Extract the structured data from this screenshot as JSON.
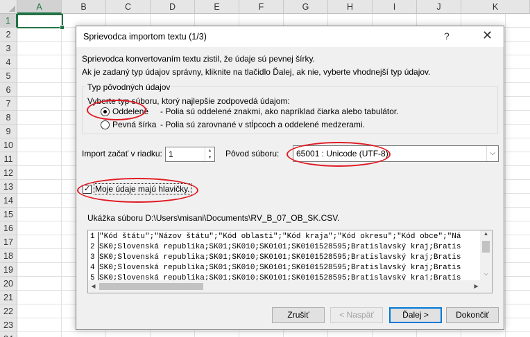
{
  "spreadsheet": {
    "columns": [
      "A",
      "B",
      "C",
      "D",
      "E",
      "F",
      "G",
      "H",
      "I",
      "J",
      "K"
    ],
    "rows": [
      "1",
      "2",
      "3",
      "4",
      "5",
      "6",
      "7",
      "8",
      "9",
      "10",
      "11",
      "12",
      "13",
      "14",
      "15",
      "16",
      "17",
      "18",
      "19",
      "20",
      "21",
      "22",
      "23",
      "24"
    ],
    "selected_column": "A",
    "selected_row": "1",
    "accent_color": "#217346"
  },
  "dialog": {
    "title": "Sprievodca importom textu (1/3)",
    "help_icon": "?",
    "close_icon": "✕",
    "intro_line1": "Sprievodca konvertovaním textu zistil, že údaje sú pevnej šírky.",
    "intro_line2": "Ak je zadaný typ údajov správny, kliknite na tlačidlo Ďalej, ak nie, vyberte vhodnejší typ údajov.",
    "group": {
      "legend": "Typ pôvodných údajov",
      "hint": "Vyberte typ súboru, ktorý najlepšie zodpovedá údajom:",
      "options": [
        {
          "label": "Oddelené",
          "description": "- Polia sú oddelené znakmi, ako napríklad čiarka alebo tabulátor.",
          "selected": true
        },
        {
          "label": "Pevná šírka",
          "description": "- Polia sú zarovnané v stĺpcoch a oddelené medzerami.",
          "selected": false
        }
      ]
    },
    "start_row": {
      "label": "Import začať v riadku:",
      "value": "1"
    },
    "origin": {
      "label": "Pôvod súboru:",
      "value": "65001 : Unicode (UTF-8)"
    },
    "headers": {
      "label": "Moje údaje majú hlavičky.",
      "checked": true,
      "check_glyph": "✓"
    },
    "preview": {
      "label": "Ukážka súboru D:\\Users\\misani\\Documents\\RV_B_07_OB_SK.CSV.",
      "rows": [
        {
          "num": "1",
          "text": "\"Kód štátu\";\"Názov štátu\";\"Kód oblasti\";\"Kód kraja\";\"Kód okresu\";\"Kód obce\";\"Ná"
        },
        {
          "num": "2",
          "text": "SK0;Slovenská republika;SK01;SK010;SK0101;SK0101528595;Bratislavský kraj;Bratis"
        },
        {
          "num": "3",
          "text": "SK0;Slovenská republika;SK01;SK010;SK0101;SK0101528595;Bratislavský kraj;Bratis"
        },
        {
          "num": "4",
          "text": "SK0;Slovenská republika;SK01;SK010;SK0101;SK0101528595;Bratislavský kraj;Bratis"
        },
        {
          "num": "5",
          "text": "SK0;Slovenská republika;SK01;SK010;SK0101;SK0101528595;Bratislavský kraj;Bratis"
        }
      ]
    },
    "buttons": {
      "cancel": "Zrušiť",
      "back": "< Naspäť",
      "next": "Ďalej >",
      "finish": "Dokončiť"
    },
    "annotation_color": "#e01a22",
    "focus_color": "#0078d7"
  }
}
